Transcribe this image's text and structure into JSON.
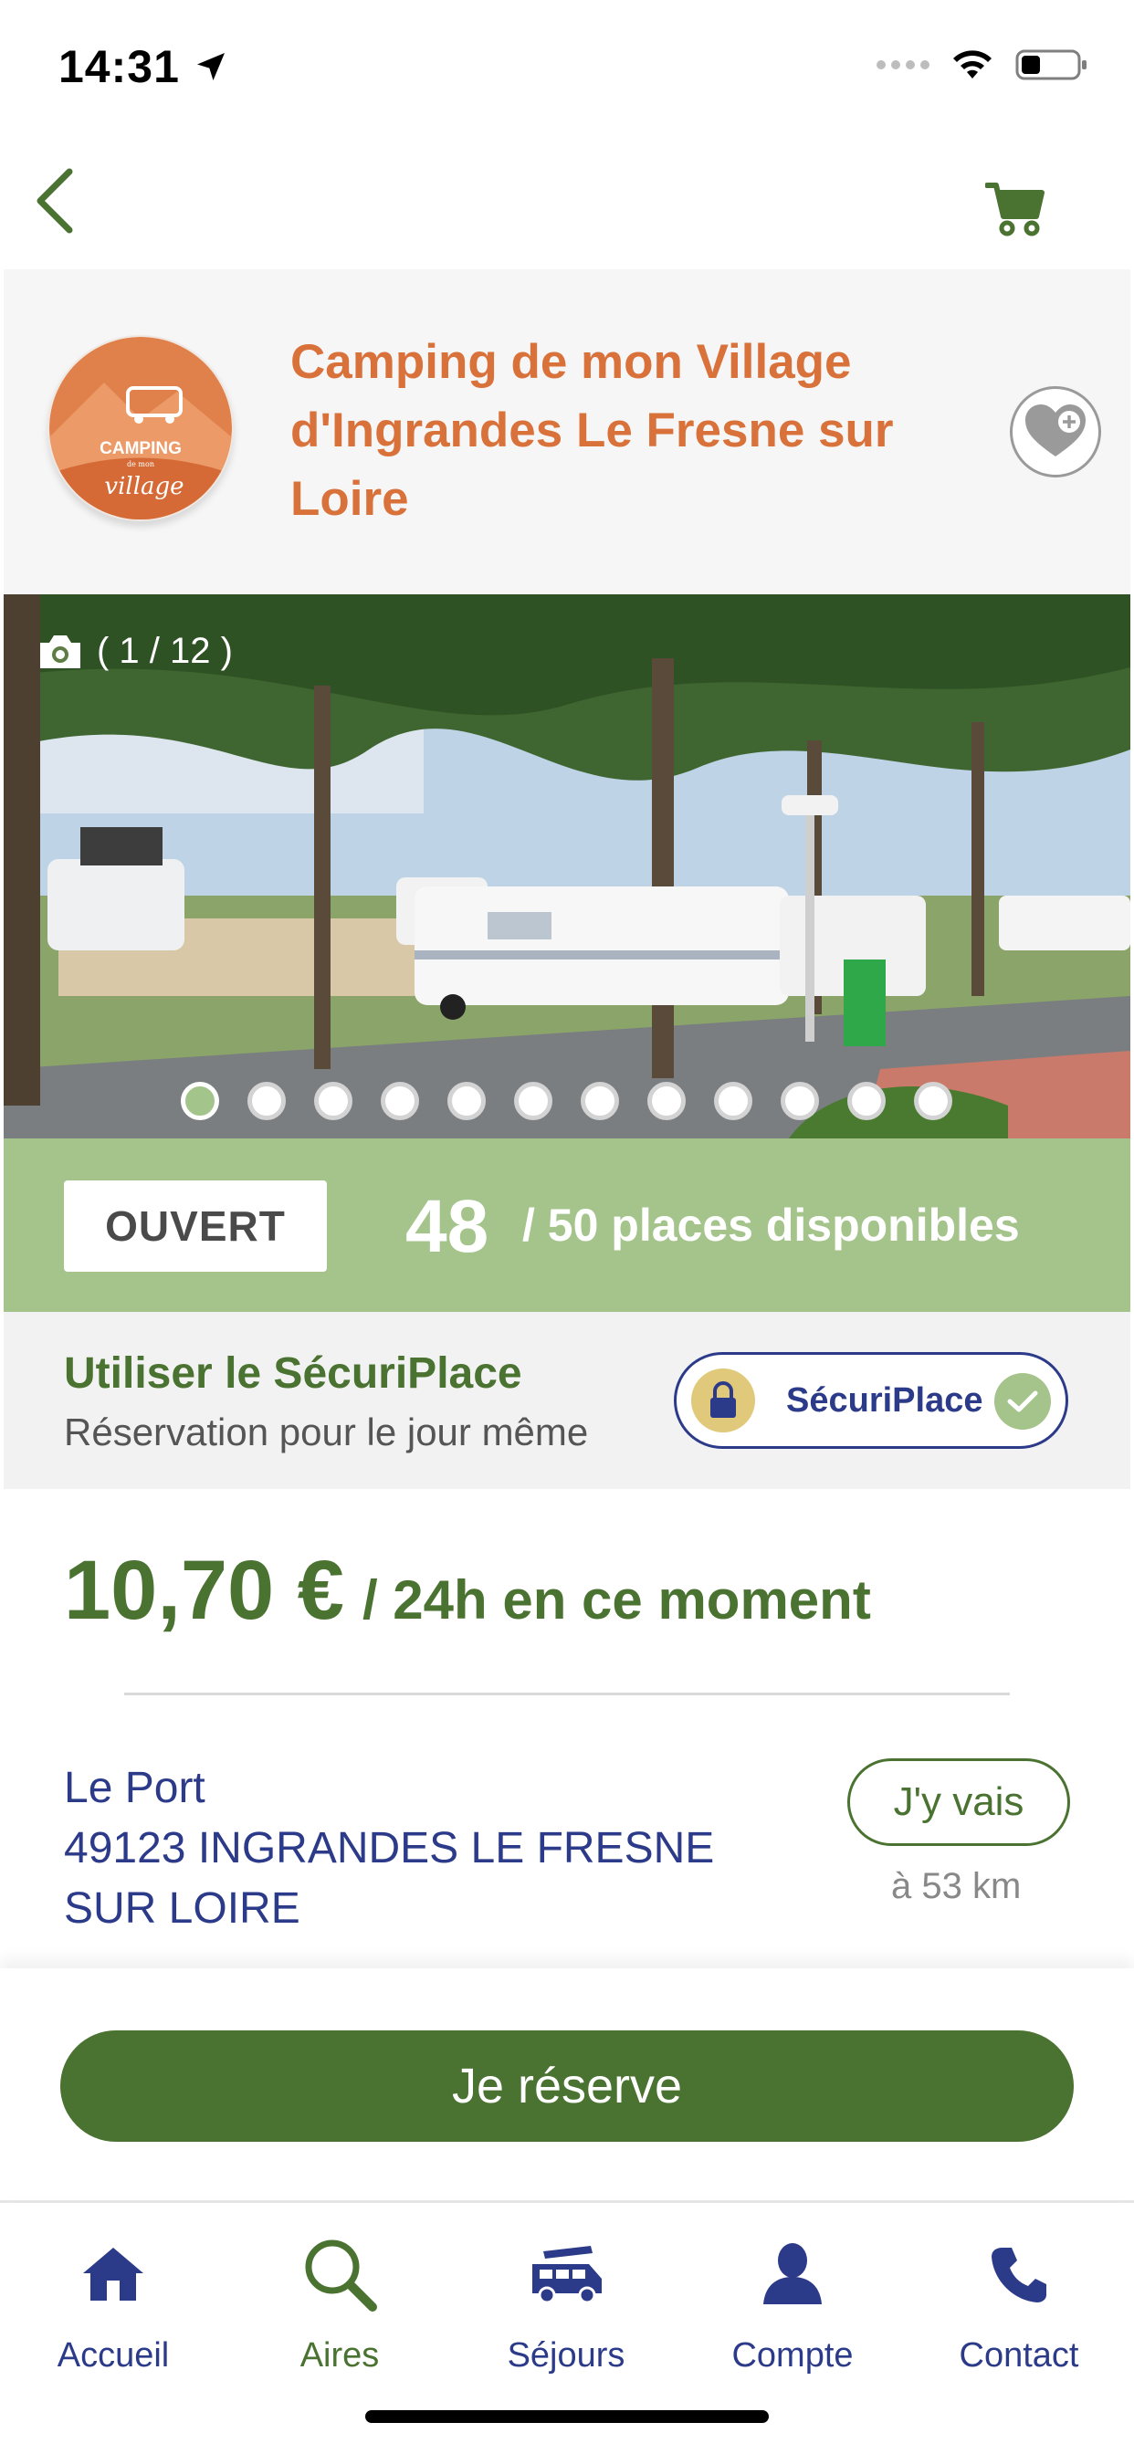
{
  "status": {
    "time": "14:31"
  },
  "camping": {
    "title": "Camping de mon Village d'Ingrandes Le Fresne sur Loire"
  },
  "carousel": {
    "counter": "( 1 / 12 )",
    "current": 1,
    "total": 12
  },
  "availability": {
    "status": "OUVERT",
    "available": "48",
    "label": "/ 50 places disponibles"
  },
  "securiplace": {
    "title": "Utiliser le SécuriPlace",
    "subtitle": "Réservation pour le jour même",
    "badge": "SécuriPlace"
  },
  "price": {
    "amount": "10,70 €",
    "suffix": "/ 24h en ce moment"
  },
  "address": {
    "line1": "Le Port",
    "line2": "49123 INGRANDES LE FRESNE SUR LOIRE"
  },
  "navigation": {
    "go_label": "J'y vais",
    "distance": "à 53 km"
  },
  "reserve": {
    "label": "Je réserve"
  },
  "tabs": [
    {
      "label": "Accueil",
      "icon": "home-icon"
    },
    {
      "label": "Aires",
      "icon": "search-icon"
    },
    {
      "label": "Séjours",
      "icon": "van-icon"
    },
    {
      "label": "Compte",
      "icon": "user-icon"
    },
    {
      "label": "Contact",
      "icon": "phone-icon"
    }
  ],
  "colors": {
    "green": "#4a7230",
    "light_green": "#a4c48b",
    "orange": "#d9713b",
    "navy": "#2c3a8a"
  }
}
